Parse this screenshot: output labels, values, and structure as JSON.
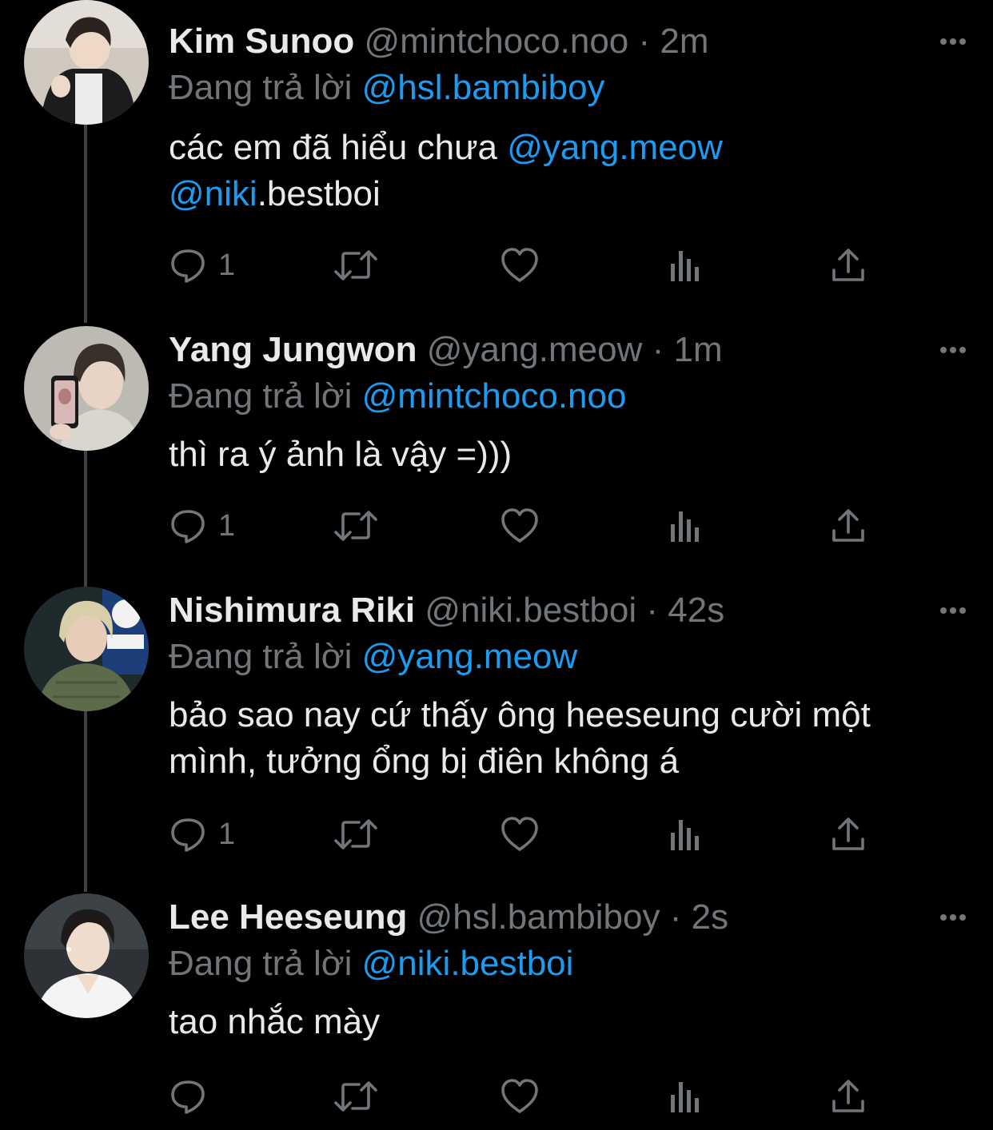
{
  "colors": {
    "background": "#000000",
    "text": "#e7e9ea",
    "muted": "#71767b",
    "mention": "#1d9bf0",
    "thread_line": "#3e4144"
  },
  "icons": {
    "reply": "reply-icon",
    "retweet": "retweet-icon",
    "like": "heart-icon",
    "views": "views-icon",
    "share": "share-icon",
    "more": "more-icon"
  },
  "tweets": [
    {
      "name": "Kim Sunoo",
      "handle": "@mintchoco.noo",
      "separator": "·",
      "time": "2m",
      "replying_label": "Đang trả lời",
      "replying_to": "@hsl.bambiboy",
      "text_plain_1": "các em đã hiểu chưa ",
      "mention_1": "@yang.meow",
      "mention_2": "@niki",
      "text_plain_2": ".bestboi",
      "reply_count": "1"
    },
    {
      "name": "Yang Jungwon",
      "handle": "@yang.meow",
      "separator": "·",
      "time": "1m",
      "replying_label": "Đang trả lời",
      "replying_to": "@mintchoco.noo",
      "text": "thì ra ý ảnh là vậy =)))",
      "reply_count": "1"
    },
    {
      "name": "Nishimura Riki",
      "handle": "@niki.bestboi",
      "separator": "·",
      "time": "42s",
      "replying_label": "Đang trả lời",
      "replying_to": "@yang.meow",
      "text_line_1": "bảo sao nay cứ thấy ông heeseung cười một",
      "text_line_2": "mình, tưởng ổng bị điên không á",
      "reply_count": "1"
    },
    {
      "name": "Lee Heeseung",
      "handle": "@hsl.bambiboy",
      "separator": "·",
      "time": "2s",
      "replying_label": "Đang trả lời",
      "replying_to": "@niki.bestboi",
      "text": "tao nhắc mày",
      "reply_count": ""
    }
  ]
}
